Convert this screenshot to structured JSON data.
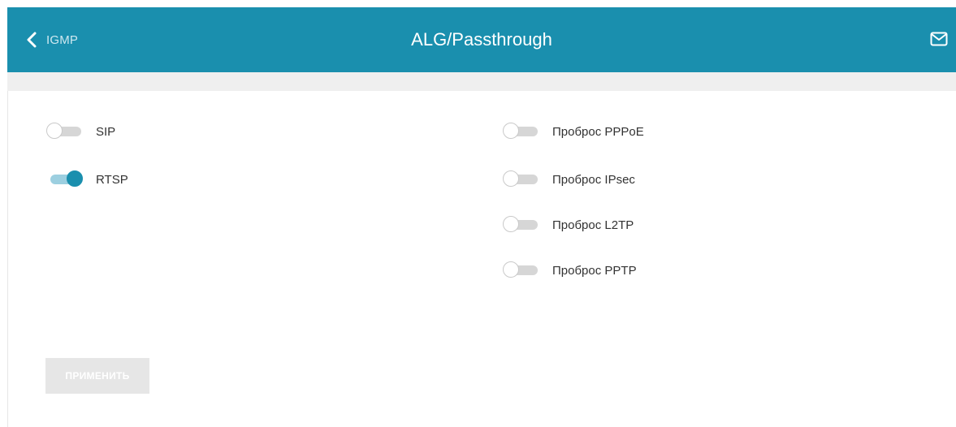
{
  "header": {
    "back_label": "IGMP",
    "title": "ALG/Passthrough",
    "mail_icon": "envelope-icon"
  },
  "colors": {
    "header_bg": "#1a8fae",
    "toggle_on": "#1a8fae",
    "toggle_on_track": "#9ccfe0",
    "toggle_off_track": "#d6d6d6"
  },
  "left_options": [
    {
      "label": "SIP",
      "enabled": false
    },
    {
      "label": "RTSP",
      "enabled": true
    }
  ],
  "right_options": [
    {
      "label": "Проброс PPPoE",
      "enabled": false
    },
    {
      "label": "Проброс IPsec",
      "enabled": false
    },
    {
      "label": "Проброс L2TP",
      "enabled": false
    },
    {
      "label": "Проброс PPTP",
      "enabled": false
    }
  ],
  "apply_button": {
    "label": "ПРИМЕНИТЬ",
    "disabled": true
  }
}
